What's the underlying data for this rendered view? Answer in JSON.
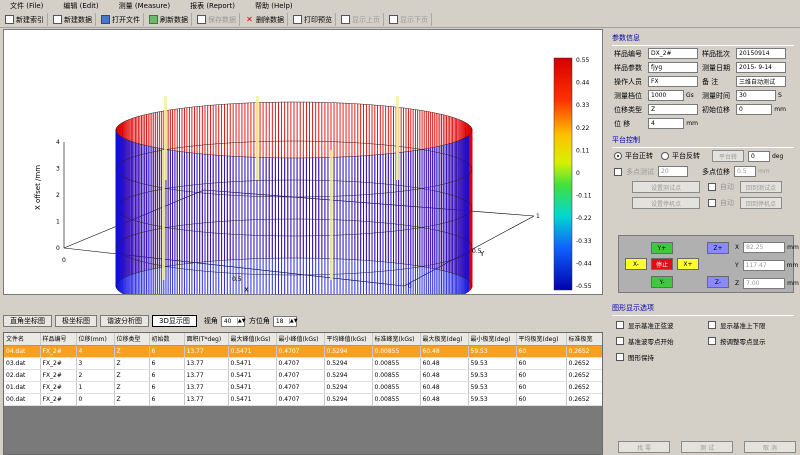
{
  "menu": [
    "文件 (File)",
    "编辑 (Edit)",
    "测量 (Measure)",
    "报表 (Report)",
    "帮助 (Help)"
  ],
  "toolbar": [
    {
      "label": "新建索引",
      "icon": "new-index-icon",
      "enabled": true
    },
    {
      "label": "新建数据",
      "icon": "new-data-icon",
      "enabled": true
    },
    {
      "label": "打开文件",
      "icon": "open-file-icon",
      "enabled": true
    },
    {
      "label": "刷新数据",
      "icon": "refresh-icon",
      "enabled": true
    },
    {
      "label": "保存数据",
      "icon": "save-icon",
      "enabled": false
    },
    {
      "label": "删除数据",
      "icon": "delete-icon",
      "enabled": true
    },
    {
      "label": "打印预览",
      "icon": "print-preview-icon",
      "enabled": true
    },
    {
      "label": "显示上页",
      "icon": "prev-page-icon",
      "enabled": false
    },
    {
      "label": "显示下页",
      "icon": "next-page-icon",
      "enabled": false
    }
  ],
  "chart_data": {
    "type": "3d-cylinder",
    "zlabel": "X offset /mm",
    "xlabel": "X",
    "ylabel": "Y",
    "z_ticks": [
      "0",
      "1",
      "2",
      "3",
      "4"
    ],
    "x_ticks": [
      "0",
      "0.5",
      "1"
    ],
    "y_ticks": [
      "0",
      "0.5",
      "1"
    ],
    "colorbar_ticks": [
      "0.55",
      "0.44",
      "0.33",
      "0.22",
      "0.11",
      "0",
      "-0.11",
      "-0.22",
      "-0.33",
      "-0.44",
      "-0.55"
    ],
    "colorbar_range": [
      -0.55,
      0.55
    ]
  },
  "view_tabs": {
    "items": [
      "直角坐标图",
      "极坐标图",
      "谐波分析图",
      "3D显示图"
    ],
    "active": 3,
    "view_angle_label": "视角",
    "view_angle_value": "40",
    "azimuth_label": "方位角",
    "azimuth_value": "18"
  },
  "table": {
    "headers": [
      "文件名",
      "样品编号",
      "位移(mm)",
      "位移类型",
      "初始数",
      "面积(T*deg)",
      "最大峰值(kGs)",
      "最小峰值(kGs)",
      "平均峰值(kGs)",
      "标准峰宽(kGs)",
      "最大极宽(deg)",
      "最小极宽(deg)",
      "平均极宽(deg)",
      "标准极宽"
    ],
    "rows": [
      [
        "04.dat",
        "FX_2#",
        "4",
        "Z",
        "6",
        "13.77",
        "0.5471",
        "0.4707",
        "0.5294",
        "0.00855",
        "60.48",
        "59.53",
        "60",
        "0.2652"
      ],
      [
        "03.dat",
        "FX_2#",
        "3",
        "Z",
        "6",
        "13.77",
        "0.5471",
        "0.4707",
        "0.5294",
        "0.00855",
        "60.48",
        "59.53",
        "60",
        "0.2652"
      ],
      [
        "02.dat",
        "FX_2#",
        "2",
        "Z",
        "6",
        "13.77",
        "0.5471",
        "0.4707",
        "0.5294",
        "0.00855",
        "60.48",
        "59.53",
        "60",
        "0.2652"
      ],
      [
        "01.dat",
        "FX_2#",
        "1",
        "Z",
        "6",
        "13.77",
        "0.5471",
        "0.4707",
        "0.5294",
        "0.00855",
        "60.48",
        "59.53",
        "60",
        "0.2652"
      ],
      [
        "00.dat",
        "FX_2#",
        "0",
        "Z",
        "6",
        "13.77",
        "0.5471",
        "0.4707",
        "0.5294",
        "0.00855",
        "60.48",
        "59.53",
        "60",
        "0.2652"
      ]
    ],
    "selected_row": 0
  },
  "params": {
    "title": "参数信息",
    "sample_no_label": "样品编号",
    "sample_no": "DX_2#",
    "batch_label": "样品批次",
    "batch": "20150914",
    "spec_label": "样品参数",
    "spec": "fjyg",
    "date_label": "测量日期",
    "date": "2015- 9-14",
    "operator_label": "操作人员",
    "operator": "FX",
    "note_label": "备    注",
    "note": "三维自动测试",
    "range_label": "测量档位",
    "range": "1000",
    "range_unit": "Gs",
    "time_label": "测量时间",
    "time": "30",
    "time_unit": "S",
    "disp_type_label": "位移类型",
    "disp_type": "Z",
    "init_disp_label": "初始位移",
    "init_disp": "0",
    "init_disp_unit": "mm",
    "disp_label": "位    移",
    "disp": "4",
    "disp_unit": "mm"
  },
  "platform": {
    "title": "平台控制",
    "forward_label": "平台正转",
    "reverse_label": "平台反转",
    "platform_btn": "平台转",
    "angle_value": "0",
    "angle_unit": "deg",
    "multipoint_label": "多点测试",
    "multipoint_value": "20",
    "multipos_label": "多点位移",
    "multipos_value": "0.5",
    "multipos_unit": "mm",
    "set_test_point": "设置测试点",
    "auto1": "自动",
    "back_test_point": "回到测试点",
    "set_stop_point": "设置停机点",
    "auto2": "自动",
    "back_stop_point": "回到停机点",
    "y_plus": "Y+",
    "z_plus": "Z+",
    "x_minus": "X-",
    "stop": "停止",
    "x_plus": "X+",
    "y_minus": "Y-",
    "z_minus": "Z-",
    "x_label": "X",
    "x_value": "82.25",
    "y_label": "Y",
    "y_value": "117.47",
    "z_label": "Z",
    "z_value": "7.00",
    "coord_unit": "mm"
  },
  "display": {
    "title": "图形显示选项",
    "options": [
      "显示基准正弦波",
      "显示基准上下限",
      "基准波零点开始",
      "按调整零点显示",
      "图形保持"
    ]
  },
  "bottom": {
    "zero": "找 零",
    "test": "测 试",
    "cancel": "取 消"
  },
  "colors": {
    "selected_row": "#f5a021",
    "cylinder_red": "#e00000",
    "cylinder_blue": "#1010e0"
  }
}
